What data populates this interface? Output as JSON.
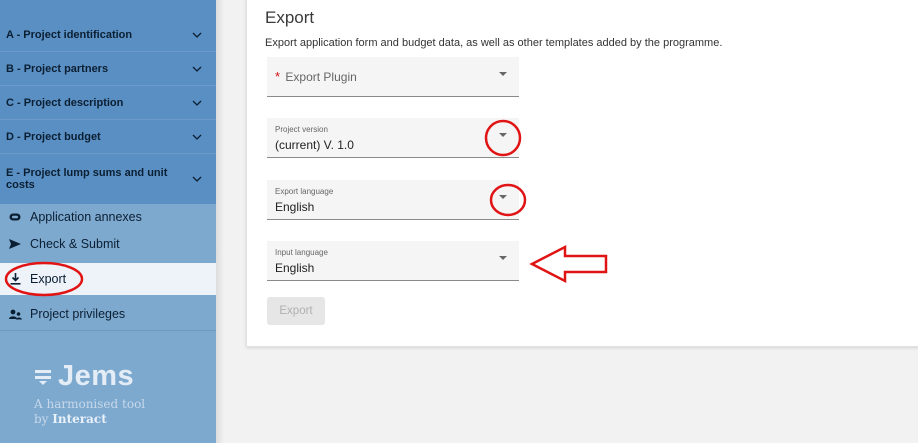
{
  "sidebar": {
    "sections": [
      {
        "label": "A - Project identification"
      },
      {
        "label": "B - Project partners"
      },
      {
        "label": "C - Project description"
      },
      {
        "label": "D - Project budget"
      },
      {
        "label": "E - Project lump sums and unit costs"
      }
    ],
    "nav": [
      {
        "label": "Application annexes",
        "icon": "annex-icon"
      },
      {
        "label": "Check & Submit",
        "icon": "send-icon"
      },
      {
        "label": "Export",
        "icon": "download-icon",
        "active": true
      },
      {
        "label": "Project privileges",
        "icon": "users-icon"
      }
    ],
    "logo": {
      "name": "Jems",
      "tagline_1": "A harmonised tool",
      "tagline_2_prefix": "by ",
      "tagline_2_brand": "Interact"
    }
  },
  "main": {
    "title": "Export",
    "description": "Export application form and budget data, as well as other templates added by the programme.",
    "fields": {
      "plugin": {
        "required_mark": "*",
        "placeholder": "Export Plugin",
        "value": ""
      },
      "project_version": {
        "label": "Project version",
        "value": "(current) V. 1.0"
      },
      "export_language": {
        "label": "Export language",
        "value": "English"
      },
      "input_language": {
        "label": "Input language",
        "value": "English"
      }
    },
    "export_button": "Export"
  },
  "colors": {
    "sidebar_bg": "#7ea9cf",
    "accordion_bg": "#5a8fc3",
    "active_nav_bg": "#eef3f9",
    "annotation_red": "#e01414",
    "required_red": "#d01010"
  }
}
